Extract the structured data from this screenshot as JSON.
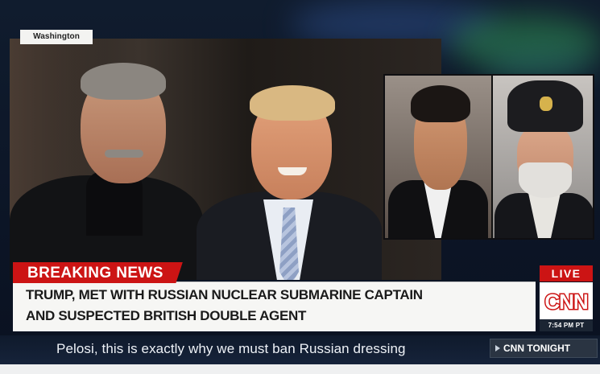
{
  "location_tag": "Washington",
  "breaking_label": "BREAKING NEWS",
  "headline": {
    "line1": "TRUMP,  MET WITH RUSSIAN NUCLEAR SUBMARINE CAPTAIN",
    "line2": "AND SUSPECTED BRITISH DOUBLE AGENT"
  },
  "network": {
    "live_label": "LIVE",
    "logo_text": "CNN",
    "time": "7:54 PM PT",
    "show_name": "CNN TONIGHT",
    "brand_red": "#cc1414"
  },
  "ticker_text": "Pelosi, this is exactly why we must ban Russian dressing",
  "icons": [
    "play-arrow-icon",
    "cnn-logo"
  ]
}
